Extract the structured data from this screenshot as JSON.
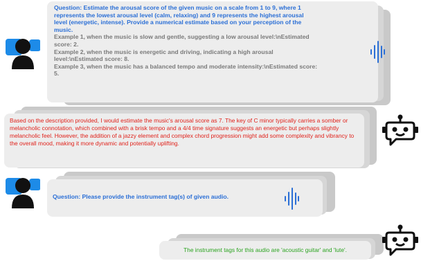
{
  "turn1_question": {
    "title": "Question: Estimate the arousal score of the given music on a scale from 1 to 9, where 1 represents the lowest arousal level (calm, relaxing) and 9 represents the highest arousal level (energetic, intense). Provide a numerical estimate based on your perception of the music.",
    "examples": [
      "Example 1, when the music is slow and gentle, suggesting a low arousal level:\\nEstimated score: 2.",
      "Example 2, when the music is energetic and driving, indicating a high arousal level:\\nEstimated score: 8.",
      "Example 3, when the music has a balanced tempo and moderate intensity:\\nEstimated score: 5."
    ]
  },
  "turn1_answer": {
    "text": "Based on the description provided, I would estimate the music's arousal score as 7. The key of C minor typically carries a somber or melancholic connotation, which combined with a brisk tempo and a 4/4 time signature suggests an energetic but perhaps slightly melancholic feel. However, the addition of a jazzy element and complex chord progression might add some complexity and vibrancy to the overall mood, making it more dynamic and potentially uplifting."
  },
  "turn2_question": {
    "text": "Question: Please provide the instrument tag(s) of given audio."
  },
  "turn2_answer": {
    "text": "The instrument tags for this audio are 'acoustic guitar' and 'lute'."
  },
  "icons": {
    "user": "user-icon",
    "robot": "robot-icon",
    "audio": "audio-waveform-icon"
  },
  "colors": {
    "question_blue": "#2b6fd6",
    "example_gray": "#7a7a7a",
    "answer_red": "#e0221b",
    "answer_green": "#2aa31f",
    "bubble": "#ededed"
  }
}
